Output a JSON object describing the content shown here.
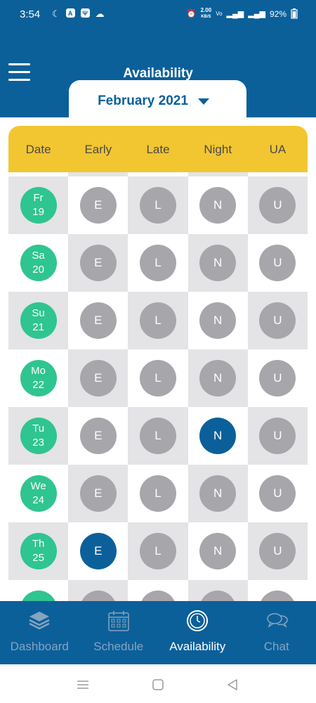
{
  "status_bar": {
    "time": "3:54",
    "speed_value": "2.00",
    "speed_unit": "KB/S",
    "battery": "92%",
    "icons": [
      "moon-icon",
      "android-icon",
      "usb-icon",
      "cloud-icon",
      "alarm-icon",
      "volte-icon",
      "signal-icon",
      "battery-icon"
    ]
  },
  "header": {
    "title": "Availability",
    "month": "February 2021"
  },
  "columns": [
    "Date",
    "Early",
    "Late",
    "Night",
    "UA"
  ],
  "rows": [
    {
      "day": "Fr",
      "date": "19",
      "early": "E",
      "late": "L",
      "night": "N",
      "ua": "U",
      "selected": []
    },
    {
      "day": "Sa",
      "date": "20",
      "early": "E",
      "late": "L",
      "night": "N",
      "ua": "U",
      "selected": []
    },
    {
      "day": "Su",
      "date": "21",
      "early": "E",
      "late": "L",
      "night": "N",
      "ua": "U",
      "selected": []
    },
    {
      "day": "Mo",
      "date": "22",
      "early": "E",
      "late": "L",
      "night": "N",
      "ua": "U",
      "selected": []
    },
    {
      "day": "Tu",
      "date": "23",
      "early": "E",
      "late": "L",
      "night": "N",
      "ua": "U",
      "selected": [
        "night"
      ]
    },
    {
      "day": "We",
      "date": "24",
      "early": "E",
      "late": "L",
      "night": "N",
      "ua": "U",
      "selected": []
    },
    {
      "day": "Th",
      "date": "25",
      "early": "E",
      "late": "L",
      "night": "N",
      "ua": "U",
      "selected": [
        "early"
      ]
    }
  ],
  "bottom_nav": [
    {
      "label": "Dashboard",
      "icon": "layers-icon",
      "active": false
    },
    {
      "label": "Schedule",
      "icon": "calendar-icon",
      "active": false
    },
    {
      "label": "Availability",
      "icon": "clock-icon",
      "active": true
    },
    {
      "label": "Chat",
      "icon": "chat-icon",
      "active": false
    }
  ],
  "colors": {
    "primary": "#0b609a",
    "header_yellow": "#f2c631",
    "date_green": "#2fc590",
    "unselected_grey": "#a7a6ab",
    "selected_blue": "#0b609a"
  }
}
